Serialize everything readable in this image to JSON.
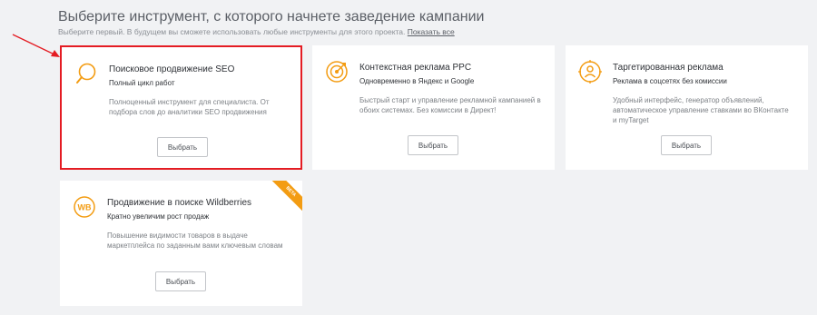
{
  "header": {
    "title": "Выберите инструмент, с которого начнете заведение кампании",
    "subtitle": "Выберите первый. В будущем вы сможете использовать любые инструменты для этого проекта.",
    "show_all_link": "Показать все"
  },
  "colors": {
    "accent": "#f39c12",
    "highlight_border": "#e41c23",
    "arrow": "#e41c23"
  },
  "cards": [
    {
      "title": "Поисковое продвижение SEO",
      "subtitle": "Полный цикл работ",
      "description": "Полноценный инструмент для специалиста. От подбора слов до аналитики SEO продвижения",
      "button": "Выбрать",
      "icon": "magnifier-icon",
      "highlighted": true
    },
    {
      "title": "Контекстная реклама PPC",
      "subtitle": "Одновременно в Яндекс и Google",
      "description": "Быстрый старт и управление рекламной кампанией в обоих системах. Без комиссии в Директ!",
      "button": "Выбрать",
      "icon": "target-icon",
      "highlighted": false
    },
    {
      "title": "Таргетированная реклама",
      "subtitle": "Реклама в соцсетях без комиссии",
      "description": "Удобный интерфейс, генератор объявлений, автоматическое управление ставками во ВКонтакте и myTarget",
      "button": "Выбрать",
      "icon": "user-target-icon",
      "highlighted": false
    },
    {
      "title": "Продвижение в поиске Wildberries",
      "subtitle": "Кратно увеличим рост продаж",
      "description": "Повышение видимости товаров в выдаче маркетплейса по заданным вами ключевым словам",
      "button": "Выбрать",
      "icon": "wb-icon",
      "icon_text": "WB",
      "badge": "BETA",
      "highlighted": false
    }
  ]
}
